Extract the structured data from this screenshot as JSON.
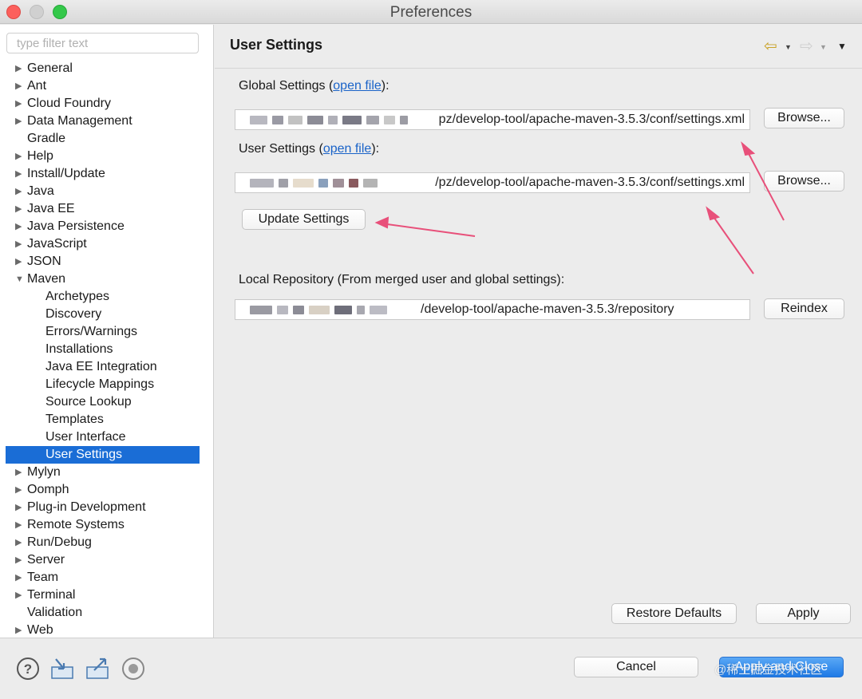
{
  "window": {
    "title": "Preferences"
  },
  "sidebar": {
    "filter_placeholder": "type filter text",
    "items": [
      {
        "label": "General",
        "expandable": true
      },
      {
        "label": "Ant",
        "expandable": true
      },
      {
        "label": "Cloud Foundry",
        "expandable": true
      },
      {
        "label": "Data Management",
        "expandable": true
      },
      {
        "label": "Gradle",
        "expandable": false
      },
      {
        "label": "Help",
        "expandable": true
      },
      {
        "label": "Install/Update",
        "expandable": true
      },
      {
        "label": "Java",
        "expandable": true
      },
      {
        "label": "Java EE",
        "expandable": true
      },
      {
        "label": "Java Persistence",
        "expandable": true
      },
      {
        "label": "JavaScript",
        "expandable": true
      },
      {
        "label": "JSON",
        "expandable": true
      },
      {
        "label": "Maven",
        "expandable": true,
        "expanded": true
      },
      {
        "label": "Archetypes",
        "child": true
      },
      {
        "label": "Discovery",
        "child": true
      },
      {
        "label": "Errors/Warnings",
        "child": true
      },
      {
        "label": "Installations",
        "child": true
      },
      {
        "label": "Java EE Integration",
        "child": true
      },
      {
        "label": "Lifecycle Mappings",
        "child": true
      },
      {
        "label": "Source Lookup",
        "child": true
      },
      {
        "label": "Templates",
        "child": true
      },
      {
        "label": "User Interface",
        "child": true
      },
      {
        "label": "User Settings",
        "child": true,
        "selected": true
      },
      {
        "label": "Mylyn",
        "expandable": true
      },
      {
        "label": "Oomph",
        "expandable": true
      },
      {
        "label": "Plug-in Development",
        "expandable": true
      },
      {
        "label": "Remote Systems",
        "expandable": true
      },
      {
        "label": "Run/Debug",
        "expandable": true
      },
      {
        "label": "Server",
        "expandable": true
      },
      {
        "label": "Team",
        "expandable": true
      },
      {
        "label": "Terminal",
        "expandable": true
      },
      {
        "label": "Validation",
        "expandable": false
      },
      {
        "label": "Web",
        "expandable": true
      }
    ]
  },
  "main": {
    "title": "User Settings",
    "global": {
      "label_prefix": "Global Settings (",
      "link": "open file",
      "label_suffix": "):",
      "path_visible": "pz/develop-tool/apache-maven-3.5.3/conf/settings.xml",
      "browse": "Browse..."
    },
    "user": {
      "label_prefix": "User Settings (",
      "link": "open file",
      "label_suffix": "):",
      "path_visible": "/pz/develop-tool/apache-maven-3.5.3/conf/settings.xml",
      "browse": "Browse..."
    },
    "update_button": "Update Settings",
    "local": {
      "label": "Local Repository (From merged user and global settings):",
      "path_visible": "/develop-tool/apache-maven-3.5.3/repository",
      "reindex": "Reindex"
    },
    "restore_defaults": "Restore Defaults",
    "apply": "Apply"
  },
  "footer": {
    "cancel": "Cancel",
    "apply_and_close": "Apply and Close",
    "watermark": "@稀土掘金技术社区"
  },
  "colors": {
    "selection": "#1a6dd6",
    "link": "#1a63c8",
    "annotation_arrow": "#e8507a",
    "primary_button": "#1e7ae6"
  }
}
